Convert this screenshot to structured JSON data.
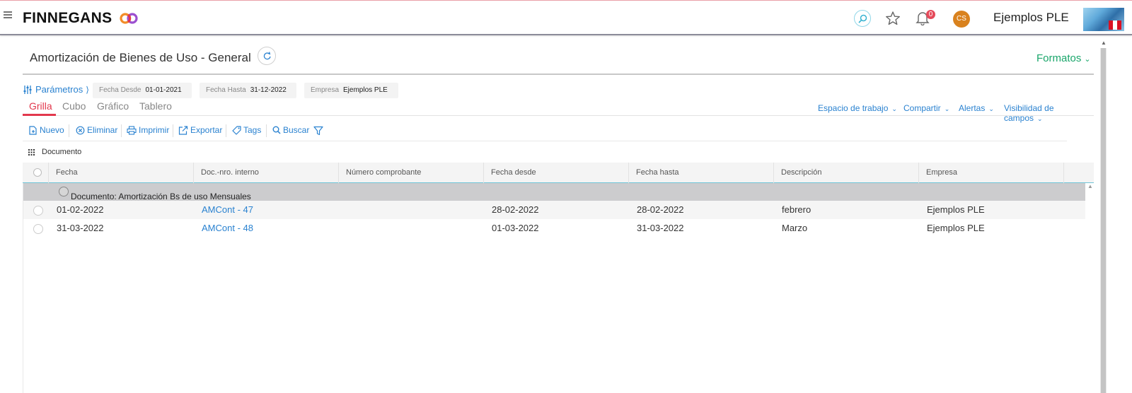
{
  "app": {
    "brand": "FINNEGANS",
    "brand_suffix": "CO",
    "notifications_count": "0",
    "user_initials": "CS",
    "company_name": "Ejemplos PLE"
  },
  "page": {
    "title": "Amortización de Bienes de Uso - General",
    "formatos_label": "Formatos"
  },
  "params": {
    "link_label": "Parámetros",
    "fields": [
      {
        "label": "Fecha Desde",
        "value": "01-01-2021"
      },
      {
        "label": "Fecha Hasta",
        "value": "31-12-2022"
      },
      {
        "label": "Empresa",
        "value": "Ejemplos PLE"
      }
    ]
  },
  "tabs": [
    {
      "label": "Grilla",
      "active": true
    },
    {
      "label": "Cubo",
      "active": false
    },
    {
      "label": "Gráfico",
      "active": false
    },
    {
      "label": "Tablero",
      "active": false
    }
  ],
  "workspace_menus": [
    "Espacio de trabajo",
    "Compartir",
    "Alertas",
    "Visibilidad de campos"
  ],
  "toolbar": {
    "nuevo": "Nuevo",
    "eliminar": "Eliminar",
    "imprimir": "Imprimir",
    "exportar": "Exportar",
    "tags": "Tags",
    "buscar": "Buscar"
  },
  "group_by_label": "Documento",
  "grid": {
    "columns": [
      "Fecha",
      "Doc.-nro. interno",
      "Número comprobante",
      "Fecha desde",
      "Fecha hasta",
      "Descripción",
      "Empresa"
    ],
    "group_header": "Documento: Amortización Bs de uso Mensuales",
    "rows": [
      {
        "fecha": "01-02-2022",
        "doc": "AMCont - 47",
        "numero": "",
        "desde": "28-02-2022",
        "hasta": "28-02-2022",
        "descripcion": "febrero",
        "empresa": "Ejemplos PLE"
      },
      {
        "fecha": "31-03-2022",
        "doc": "AMCont - 48",
        "numero": "",
        "desde": "01-03-2022",
        "hasta": "31-03-2022",
        "descripcion": "Marzo",
        "empresa": "Ejemplos PLE"
      }
    ]
  },
  "colors": {
    "accent_red": "#e2384d",
    "link_blue": "#2a82d0",
    "formatos_green": "#1aa66b",
    "avatar_orange": "#d9821e"
  }
}
